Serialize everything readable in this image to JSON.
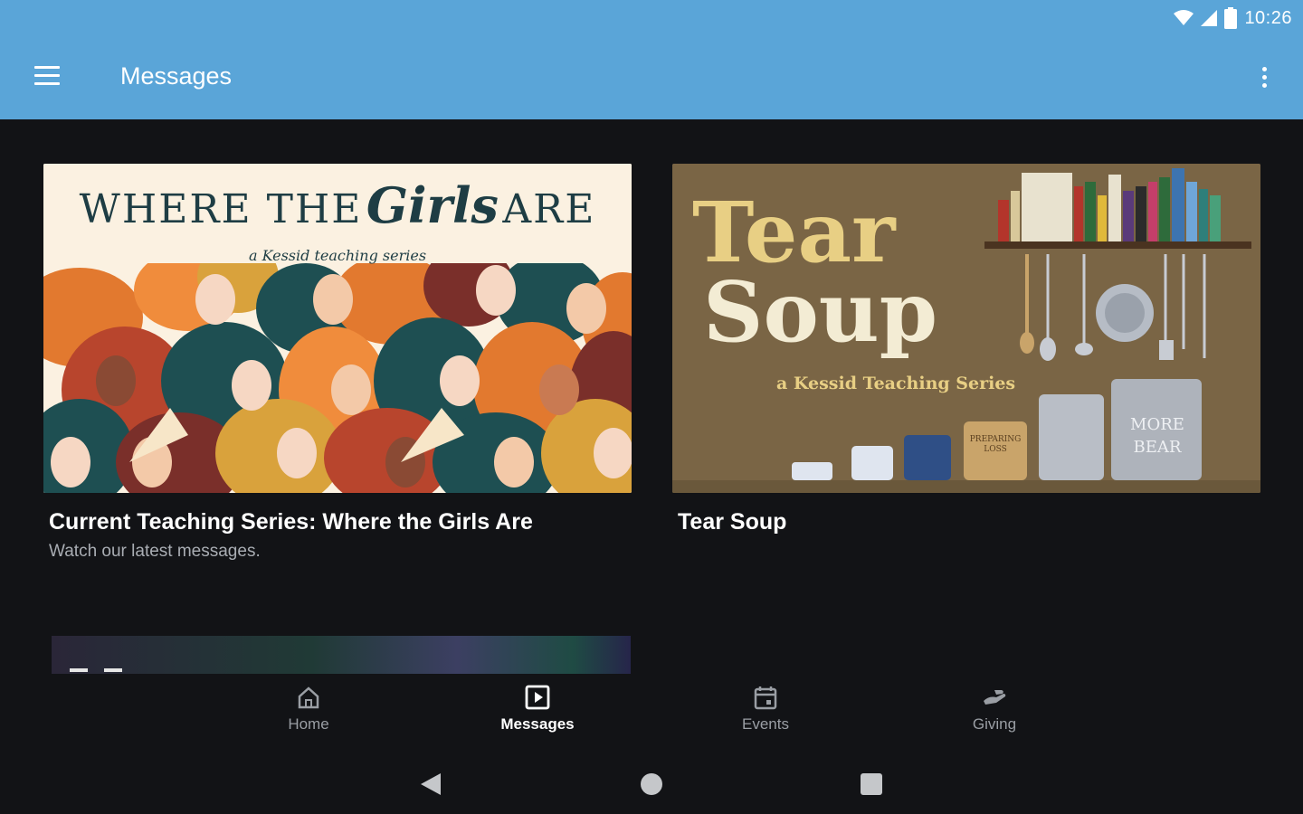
{
  "status_bar": {
    "time": "10:26",
    "icons": [
      "wifi-icon",
      "cell-signal-icon",
      "battery-icon"
    ]
  },
  "app_bar": {
    "title": "Messages",
    "menu_icon": "hamburger-menu-icon",
    "overflow_icon": "more-vert-icon"
  },
  "cards": [
    {
      "title": "Current Teaching Series: Where the Girls Are",
      "subtitle": "Watch our latest messages.",
      "image": {
        "heading_a": "WHERE THE",
        "heading_b": "Girls",
        "heading_c": "ARE",
        "tagline": "a Kessid teaching series"
      }
    },
    {
      "title": "Tear Soup",
      "subtitle": "",
      "image": {
        "heading_a": "Tear",
        "heading_b": "Soup",
        "tagline": "a Kessid Teaching Series",
        "pot_label_1": "MORE",
        "pot_label_2": "BEAR",
        "pot_small": "PREPARING LOSS"
      }
    }
  ],
  "bottom_nav": {
    "items": [
      {
        "label": "Home",
        "icon": "home-icon"
      },
      {
        "label": "Messages",
        "icon": "video-icon"
      },
      {
        "label": "Events",
        "icon": "calendar-icon"
      },
      {
        "label": "Giving",
        "icon": "giving-hand-icon"
      }
    ],
    "active": "Messages"
  },
  "system_nav": [
    "back-icon",
    "home-circle-icon",
    "recents-icon"
  ],
  "colors": {
    "app_bar": "#5aa5d8",
    "background": "#121316",
    "card_bg_1": "#fbf1e1",
    "card_bg_2": "#7a6545"
  }
}
